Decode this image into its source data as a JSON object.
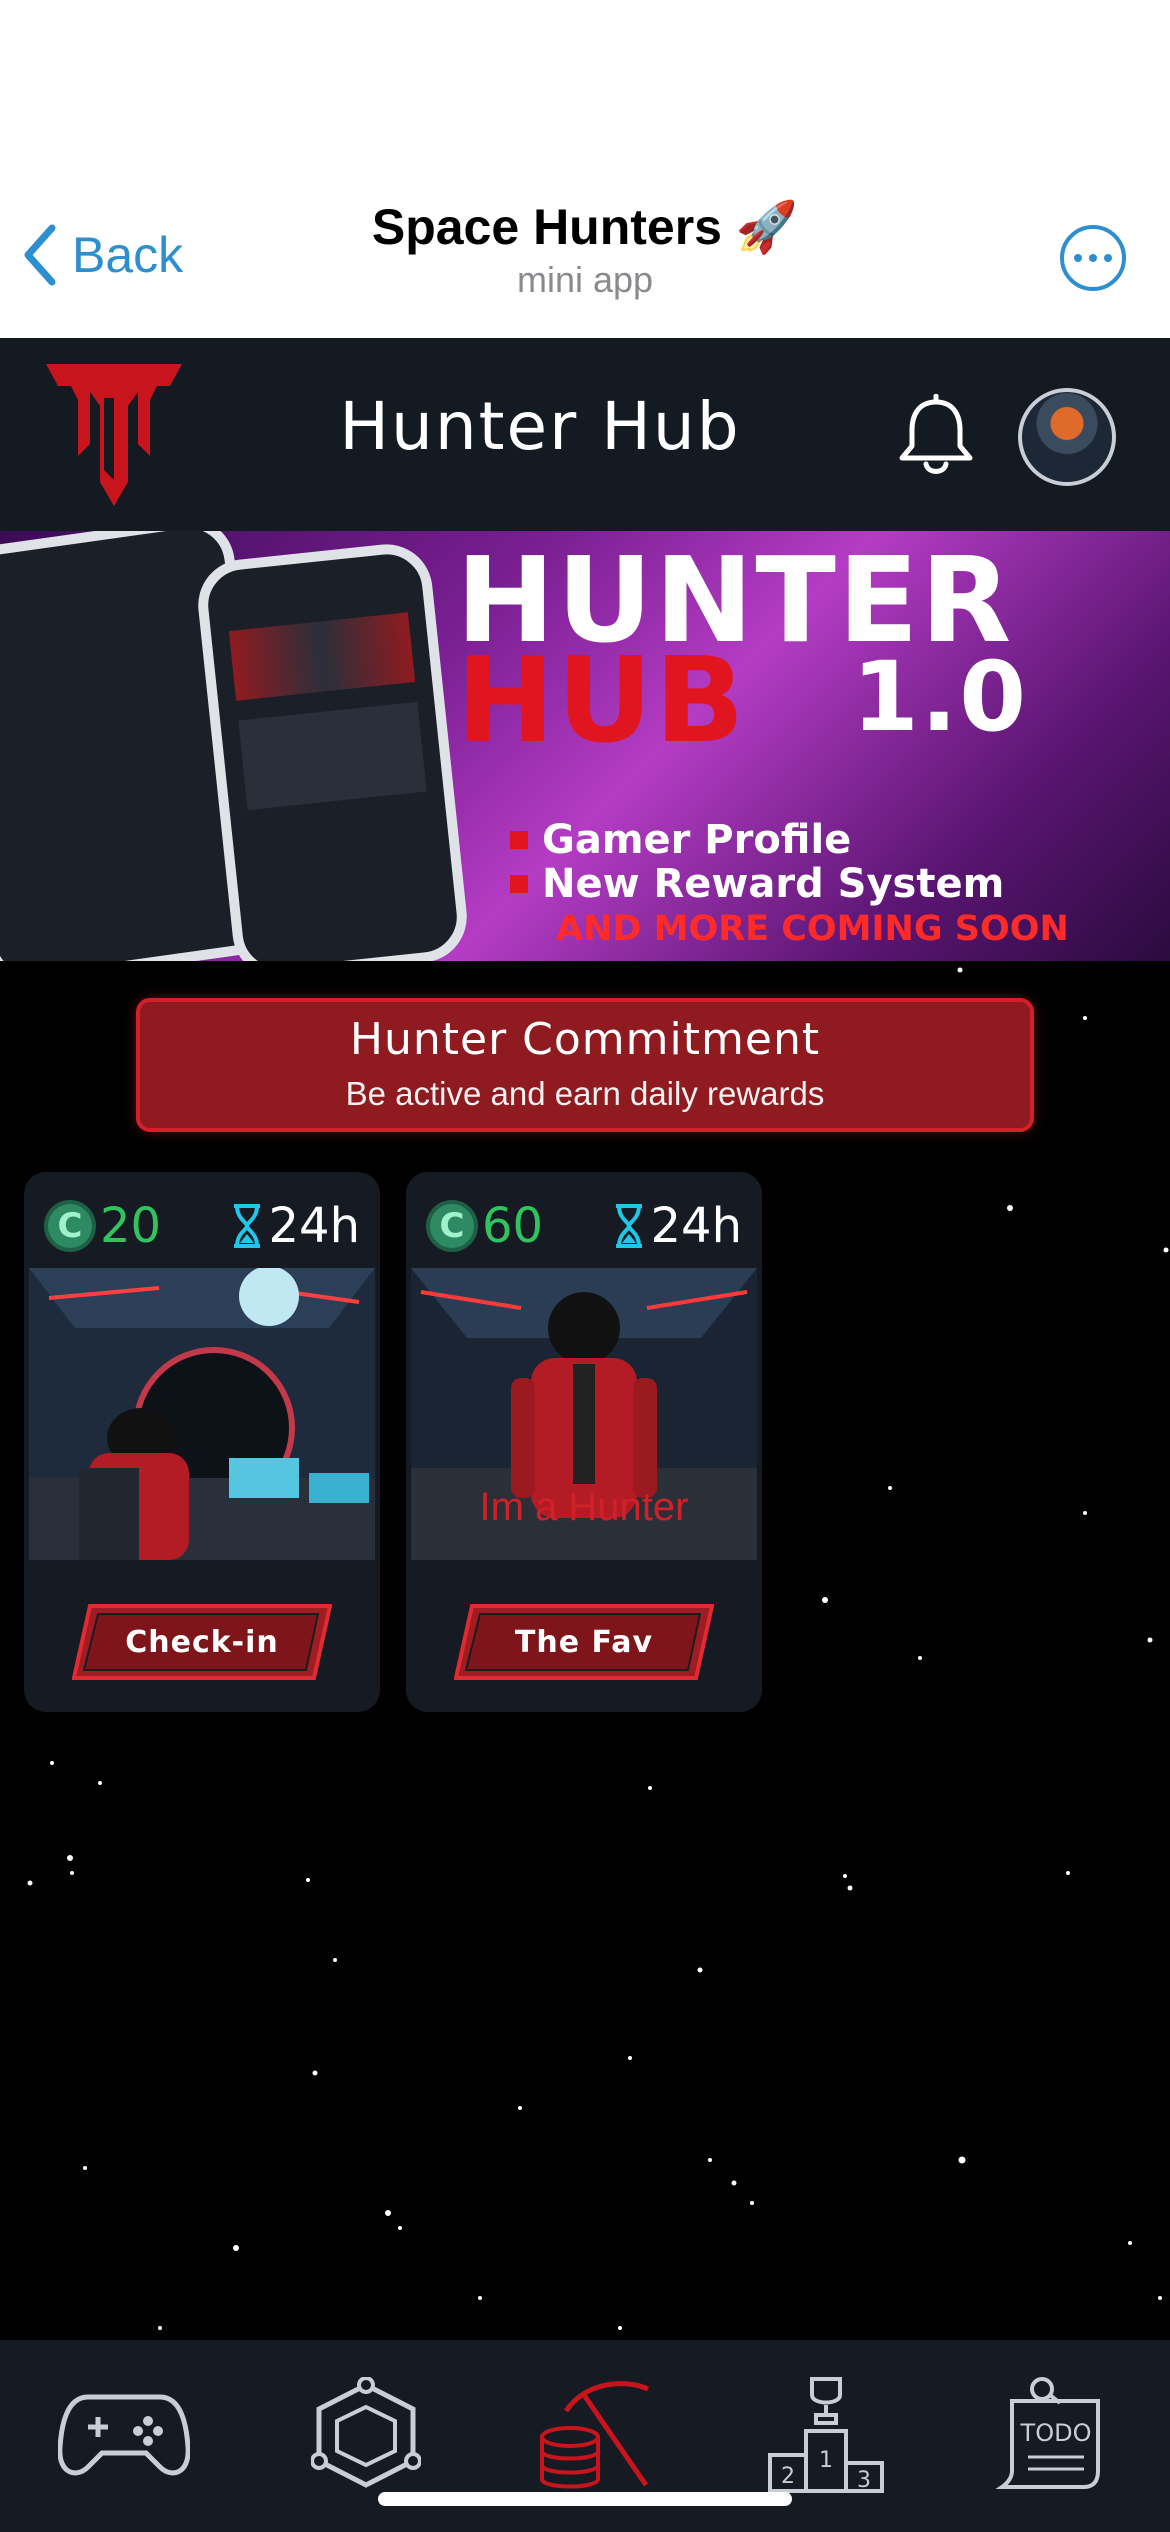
{
  "telegram": {
    "back_label": "Back",
    "title": "Space Hunters 🚀",
    "subtitle": "mini app"
  },
  "header": {
    "title": "Hunter Hub"
  },
  "banner": {
    "title_line1": "HUNTER",
    "title_line2": "HUB",
    "version": "1.0",
    "features": [
      "Gamer Profile",
      "New Reward System"
    ],
    "coming_soon": "AND MORE COMING SOON"
  },
  "commitment": {
    "title": "Hunter Commitment",
    "subtitle": "Be active and earn daily rewards"
  },
  "cards": [
    {
      "reward": "20",
      "cooldown": "24h",
      "image_caption": "",
      "button_label": "Check-in"
    },
    {
      "reward": "60",
      "cooldown": "24h",
      "image_caption": "Im a Hunter",
      "button_label": "The Fav"
    }
  ],
  "coin_symbol": "C",
  "tabs": [
    {
      "icon": "gamepad-icon",
      "label": ""
    },
    {
      "icon": "cube-icon",
      "label": ""
    },
    {
      "icon": "mining-icon",
      "label": "",
      "active": true
    },
    {
      "icon": "podium-icon",
      "label": ""
    },
    {
      "icon": "todo-icon",
      "label": "TODO"
    }
  ],
  "colors": {
    "accent_red": "#d4202a",
    "link_blue": "#2e8fd0",
    "reward_green": "#31c45e",
    "timer_cyan": "#1ec8e8"
  }
}
